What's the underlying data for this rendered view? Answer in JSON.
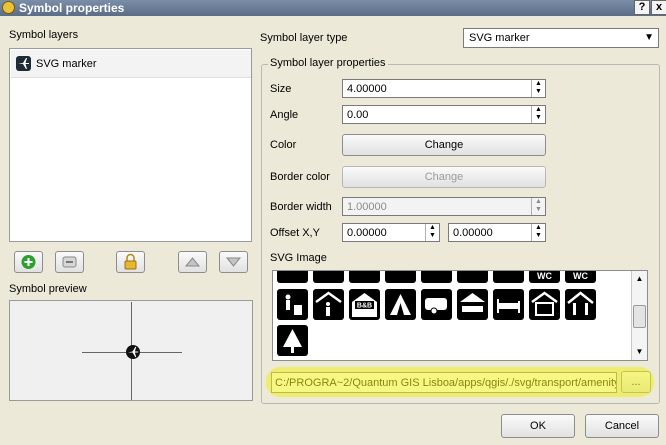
{
  "window": {
    "title": "Symbol properties",
    "help_label": "?",
    "close_label": "x"
  },
  "symbol_layers": {
    "label": "Symbol layers",
    "items": [
      {
        "label": "SVG marker",
        "icon": "airplane-icon"
      }
    ]
  },
  "symbol_preview": {
    "label": "Symbol preview"
  },
  "layer_type": {
    "label": "Symbol layer type",
    "value": "SVG marker"
  },
  "props": {
    "legend": "Symbol layer properties",
    "size": {
      "label": "Size",
      "value": "4.00000"
    },
    "angle": {
      "label": "Angle",
      "value": "0.00"
    },
    "color": {
      "label": "Color",
      "button": "Change"
    },
    "border_color": {
      "label": "Border color",
      "button": "Change"
    },
    "border_width": {
      "label": "Border width",
      "value": "1.00000"
    },
    "offset": {
      "label": "Offset X,Y",
      "x": "0.00000",
      "y": "0.00000"
    },
    "svg_image": {
      "label": "SVG Image",
      "path": "C:/PROGRA~2/Quantum GIS Lisboa/apps/qgis/./svg/transport/amenity",
      "browse": "..."
    }
  },
  "svg_tiles_top": [
    "WC",
    "WC"
  ],
  "svg_tile_text": {
    "bb": "B&B"
  },
  "footer": {
    "ok": "OK",
    "cancel": "Cancel"
  },
  "colors": {
    "highlight": "#f0f01e",
    "titlebar": "#6a7c96",
    "accent": "#2ea02e"
  }
}
